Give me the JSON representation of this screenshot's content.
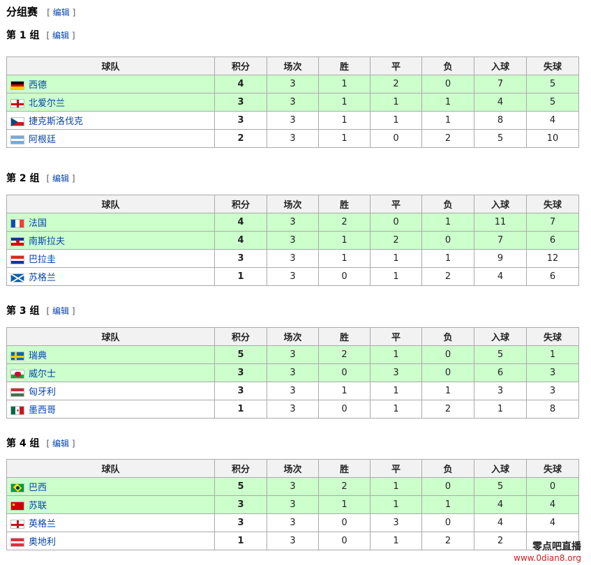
{
  "section": {
    "title": "分组赛",
    "edit": "编辑"
  },
  "columns": [
    "球队",
    "积分",
    "场次",
    "胜",
    "平",
    "负",
    "入球",
    "失球"
  ],
  "groups": [
    {
      "label": "第 1 组",
      "edit": "编辑",
      "rows": [
        {
          "team": "西德",
          "flag": "west-germany",
          "pts": "4",
          "pld": "3",
          "w": "1",
          "d": "2",
          "l": "0",
          "gf": "7",
          "ga": "5",
          "advanced": true
        },
        {
          "team": "北爱尔兰",
          "flag": "northern-ireland",
          "pts": "3",
          "pld": "3",
          "w": "1",
          "d": "1",
          "l": "1",
          "gf": "4",
          "ga": "5",
          "advanced": true
        },
        {
          "team": "捷克斯洛伐克",
          "flag": "czechoslovakia",
          "pts": "3",
          "pld": "3",
          "w": "1",
          "d": "1",
          "l": "1",
          "gf": "8",
          "ga": "4",
          "advanced": false
        },
        {
          "team": "阿根廷",
          "flag": "argentina",
          "pts": "2",
          "pld": "3",
          "w": "1",
          "d": "0",
          "l": "2",
          "gf": "5",
          "ga": "10",
          "advanced": false
        }
      ]
    },
    {
      "label": "第 2 组",
      "edit": "编辑",
      "rows": [
        {
          "team": "法国",
          "flag": "france",
          "pts": "4",
          "pld": "3",
          "w": "2",
          "d": "0",
          "l": "1",
          "gf": "11",
          "ga": "7",
          "advanced": true
        },
        {
          "team": "南斯拉夫",
          "flag": "yugoslavia",
          "pts": "4",
          "pld": "3",
          "w": "1",
          "d": "2",
          "l": "0",
          "gf": "7",
          "ga": "6",
          "advanced": true
        },
        {
          "team": "巴拉圭",
          "flag": "paraguay",
          "pts": "3",
          "pld": "3",
          "w": "1",
          "d": "1",
          "l": "1",
          "gf": "9",
          "ga": "12",
          "advanced": false
        },
        {
          "team": "苏格兰",
          "flag": "scotland",
          "pts": "1",
          "pld": "3",
          "w": "0",
          "d": "1",
          "l": "2",
          "gf": "4",
          "ga": "6",
          "advanced": false
        }
      ]
    },
    {
      "label": "第 3 组",
      "edit": "编辑",
      "rows": [
        {
          "team": "瑞典",
          "flag": "sweden",
          "pts": "5",
          "pld": "3",
          "w": "2",
          "d": "1",
          "l": "0",
          "gf": "5",
          "ga": "1",
          "advanced": true
        },
        {
          "team": "威尔士",
          "flag": "wales",
          "pts": "3",
          "pld": "3",
          "w": "0",
          "d": "3",
          "l": "0",
          "gf": "6",
          "ga": "3",
          "advanced": true
        },
        {
          "team": "匈牙利",
          "flag": "hungary",
          "pts": "3",
          "pld": "3",
          "w": "1",
          "d": "1",
          "l": "1",
          "gf": "3",
          "ga": "3",
          "advanced": false
        },
        {
          "team": "墨西哥",
          "flag": "mexico",
          "pts": "1",
          "pld": "3",
          "w": "0",
          "d": "1",
          "l": "2",
          "gf": "1",
          "ga": "8",
          "advanced": false
        }
      ]
    },
    {
      "label": "第 4 组",
      "edit": "编辑",
      "rows": [
        {
          "team": "巴西",
          "flag": "brazil",
          "pts": "5",
          "pld": "3",
          "w": "2",
          "d": "1",
          "l": "0",
          "gf": "5",
          "ga": "0",
          "advanced": true
        },
        {
          "team": "苏联",
          "flag": "soviet-union",
          "pts": "3",
          "pld": "3",
          "w": "1",
          "d": "1",
          "l": "1",
          "gf": "4",
          "ga": "4",
          "advanced": true
        },
        {
          "team": "英格兰",
          "flag": "england",
          "pts": "3",
          "pld": "3",
          "w": "0",
          "d": "3",
          "l": "0",
          "gf": "4",
          "ga": "4",
          "advanced": false
        },
        {
          "team": "奥地利",
          "flag": "austria",
          "pts": "1",
          "pld": "3",
          "w": "0",
          "d": "1",
          "l": "2",
          "gf": "2",
          "ga": "",
          "advanced": false
        }
      ]
    }
  ],
  "watermark": {
    "line1": "零点吧直播",
    "line2": "www.0dian8.org"
  },
  "colors": {
    "advanced_row": "#ccffcc",
    "header": "#f2f2f2",
    "link": "#0645ad",
    "border": "#aaaaaa"
  }
}
